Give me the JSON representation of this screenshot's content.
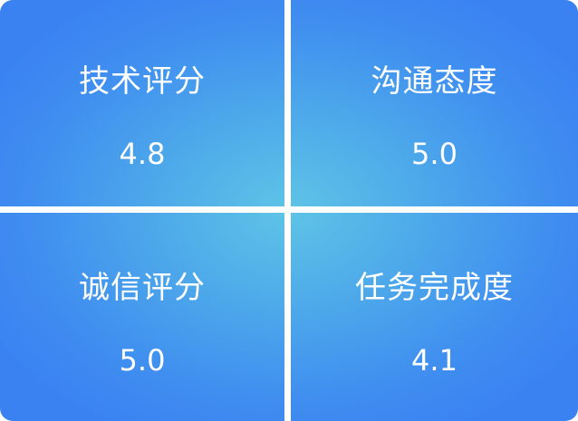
{
  "panel": {
    "background_center": "#5ec4e6",
    "background_edge": "#3a82f2",
    "divider_color": "#ffffff"
  },
  "scores": [
    {
      "label": "技术评分",
      "value": "4.8"
    },
    {
      "label": "沟通态度",
      "value": "5.0"
    },
    {
      "label": "诚信评分",
      "value": "5.0"
    },
    {
      "label": "任务完成度",
      "value": "4.1"
    }
  ]
}
